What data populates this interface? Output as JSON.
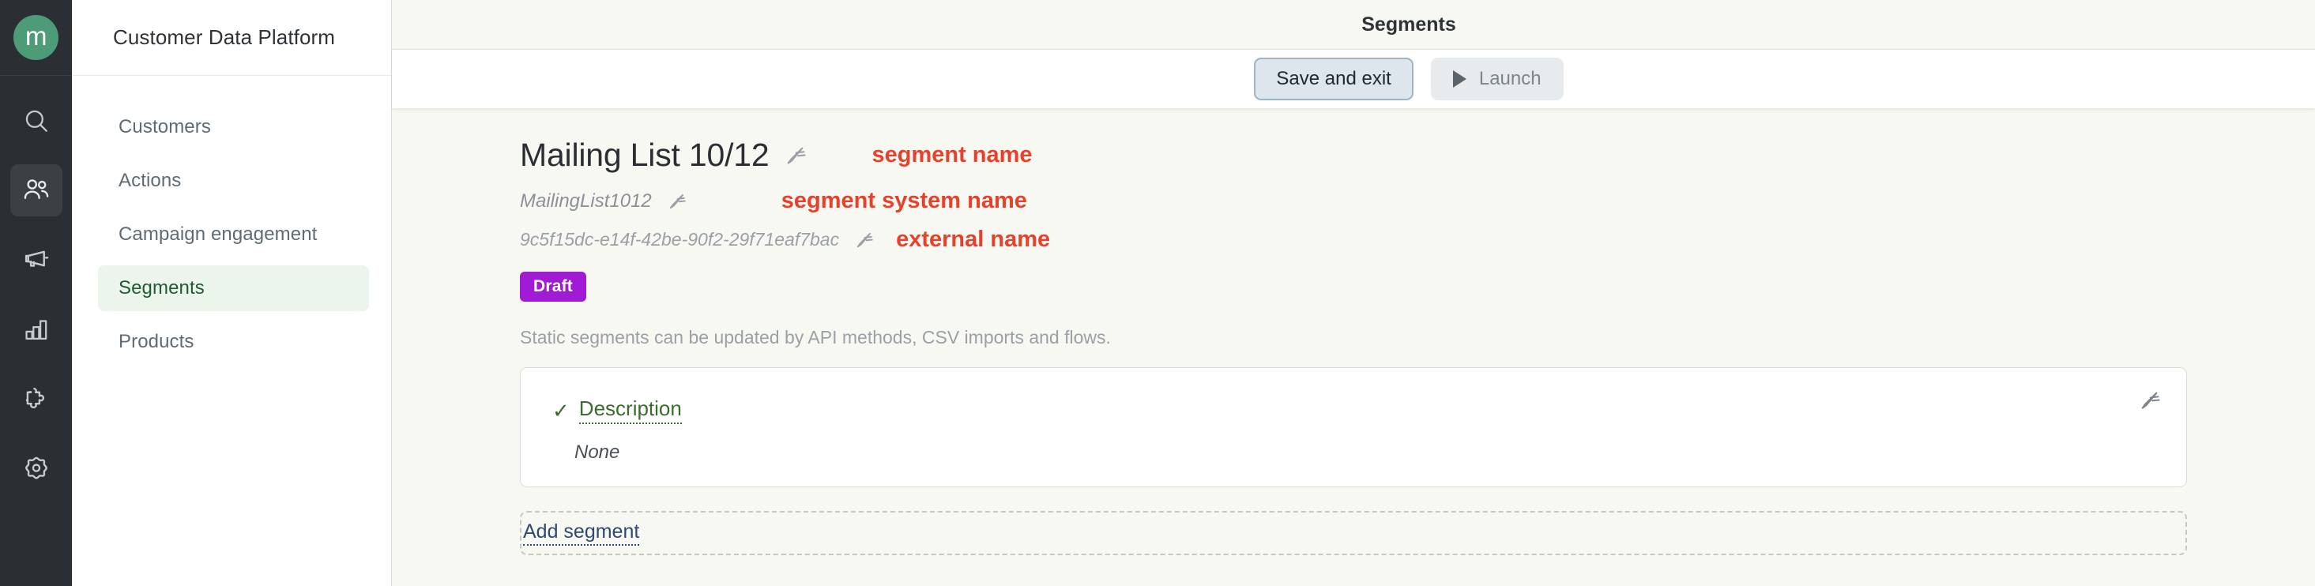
{
  "rail": {
    "logo_letter": "m",
    "items": [
      {
        "icon": "search-icon",
        "name": "search"
      },
      {
        "icon": "users-icon",
        "name": "customers",
        "active": true
      },
      {
        "icon": "megaphone-icon",
        "name": "campaigns"
      },
      {
        "icon": "bar-chart-icon",
        "name": "analytics"
      },
      {
        "icon": "puzzle-icon",
        "name": "integrations"
      },
      {
        "icon": "gear-icon",
        "name": "settings"
      }
    ]
  },
  "nav": {
    "title": "Customer Data Platform",
    "items": [
      {
        "label": "Customers",
        "active": false
      },
      {
        "label": "Actions",
        "active": false
      },
      {
        "label": "Campaign engagement",
        "active": false
      },
      {
        "label": "Segments",
        "active": true
      },
      {
        "label": "Products",
        "active": false
      }
    ]
  },
  "header": {
    "title": "Segments"
  },
  "toolbar": {
    "save_and_exit_label": "Save and exit",
    "launch_label": "Launch",
    "launch_icon": "play-icon"
  },
  "segment": {
    "name": "Mailing List 10/12",
    "system_name": "MailingList1012",
    "external_name": "9c5f15dc-e14f-42be-90f2-29f71eaf7bac",
    "status_badge": "Draft",
    "helper_text": "Static segments can be updated by API methods, CSV imports and flows.",
    "edit_icon": "pencil-icon"
  },
  "annotations": {
    "segment_name": "segment name",
    "segment_system_name": "segment system name",
    "external_name": "external name",
    "color": "#E8412B"
  },
  "description_card": {
    "check_glyph": "✓",
    "label": "Description",
    "value": "None",
    "edit_icon": "pencil-icon"
  },
  "add_segment": {
    "label": "Add segment"
  },
  "colors": {
    "rail_bg": "#2B2F33",
    "logo_green": "#4E9B77",
    "nav_active_bg": "#EBF5EC",
    "nav_active_text": "#1F5C33",
    "page_bg": "#F8F8F3",
    "badge_purple": "#A21BD4",
    "link_blue": "#2E4A73",
    "desc_green": "#3B6B2D",
    "annotation_red": "#E8412B"
  }
}
